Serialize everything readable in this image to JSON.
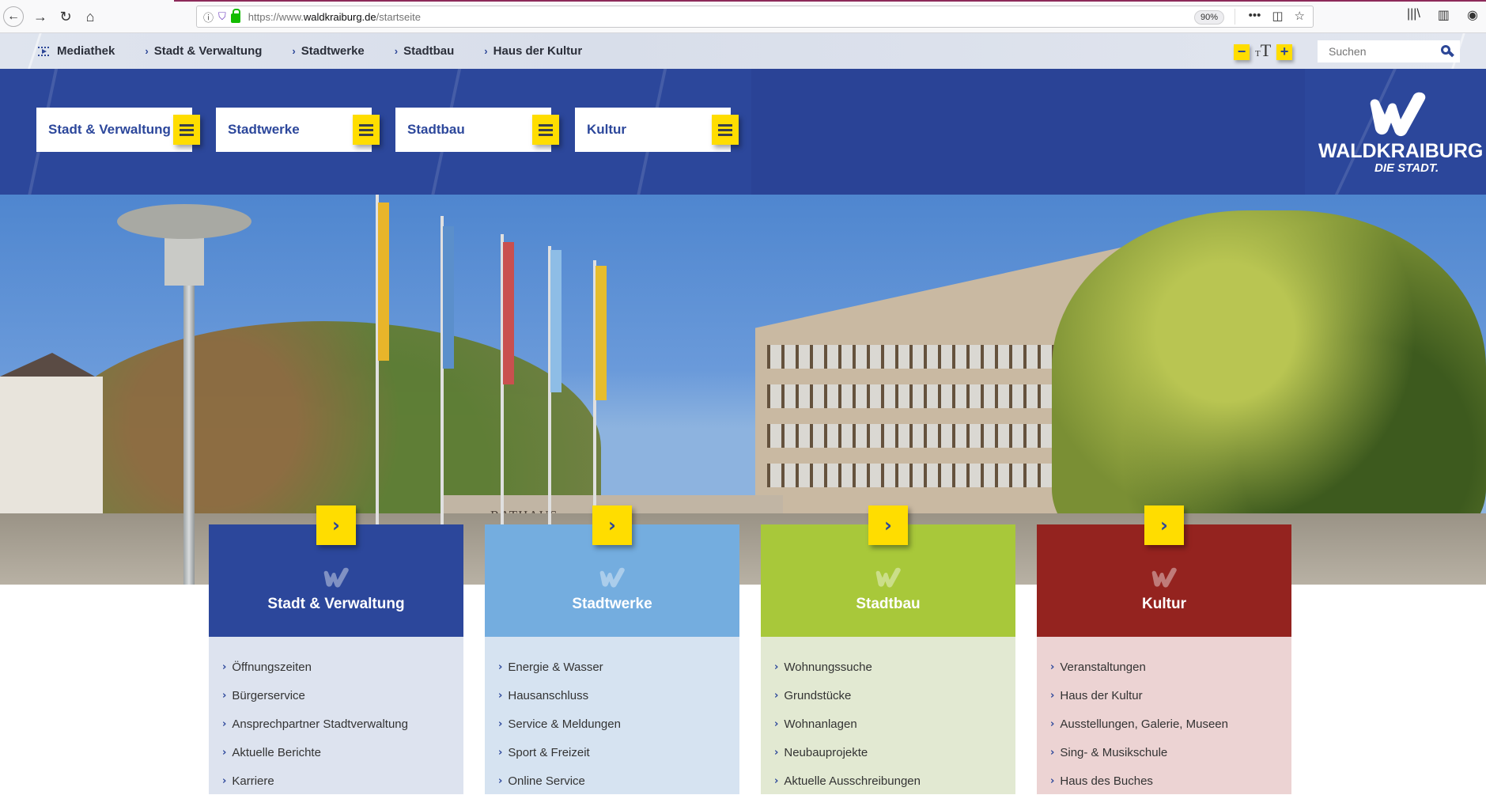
{
  "browser": {
    "url_prefix": "https://www.",
    "url_domain": "waldkraiburg.de",
    "url_path": "/startseite",
    "zoom": "90%",
    "icons": [
      "back-icon",
      "forward-icon",
      "reload-icon",
      "home-icon",
      "info-icon",
      "shield-icon",
      "lock-icon",
      "more-icon",
      "pocket-icon",
      "bookmark-star-icon",
      "library-icon",
      "sidebar-icon",
      "account-icon"
    ]
  },
  "topnav": {
    "links": [
      {
        "label": "Mediathek",
        "icon": "media-icon"
      },
      {
        "label": "Stadt & Verwaltung",
        "icon": "chevron-right-icon"
      },
      {
        "label": "Stadtwerke",
        "icon": "chevron-right-icon"
      },
      {
        "label": "Stadtbau",
        "icon": "chevron-right-icon"
      },
      {
        "label": "Haus der Kultur",
        "icon": "chevron-right-icon"
      }
    ],
    "font_size": {
      "decrease": "−",
      "label_small": "T",
      "label_large": "T",
      "increase": "+"
    },
    "search": {
      "placeholder": "Suchen",
      "value": ""
    }
  },
  "header": {
    "menus": [
      {
        "label": "Stadt & Verwaltung"
      },
      {
        "label": "Stadtwerke"
      },
      {
        "label": "Stadtbau"
      },
      {
        "label": "Kultur"
      }
    ],
    "logo": {
      "name": "WALDKRAIBURG",
      "tagline": "DIE STADT."
    }
  },
  "hero": {
    "sign_text": "RATHAUS"
  },
  "colors": {
    "brand_blue": "#2c479b",
    "accent_yellow": "#ffdd00",
    "stadtwerke": "#74addf",
    "stadtbau": "#a8c83a",
    "kultur": "#94231f"
  },
  "cards": [
    {
      "title": "Stadt & Verwaltung",
      "color": "#2c479b",
      "list_bg": "#dde3ef",
      "items": [
        "Öffnungszeiten",
        "Bürgerservice",
        "Ansprechpartner Stadtverwaltung",
        "Aktuelle Berichte",
        "Karriere"
      ]
    },
    {
      "title": "Stadtwerke",
      "color": "#74addf",
      "list_bg": "#d6e3f1",
      "items": [
        "Energie & Wasser",
        "Hausanschluss",
        "Service & Meldungen",
        "Sport & Freizeit",
        "Online Service"
      ]
    },
    {
      "title": "Stadtbau",
      "color": "#a8c83a",
      "list_bg": "#e2e9d2",
      "items": [
        "Wohnungssuche",
        "Grundstücke",
        "Wohnanlagen",
        "Neubauprojekte",
        "Aktuelle Ausschreibungen"
      ]
    },
    {
      "title": "Kultur",
      "color": "#94231f",
      "list_bg": "#ecd3d3",
      "items": [
        "Veranstaltungen",
        "Haus der Kultur",
        "Ausstellungen, Galerie, Museen",
        "Sing- & Musikschule",
        "Haus des Buches"
      ]
    }
  ]
}
